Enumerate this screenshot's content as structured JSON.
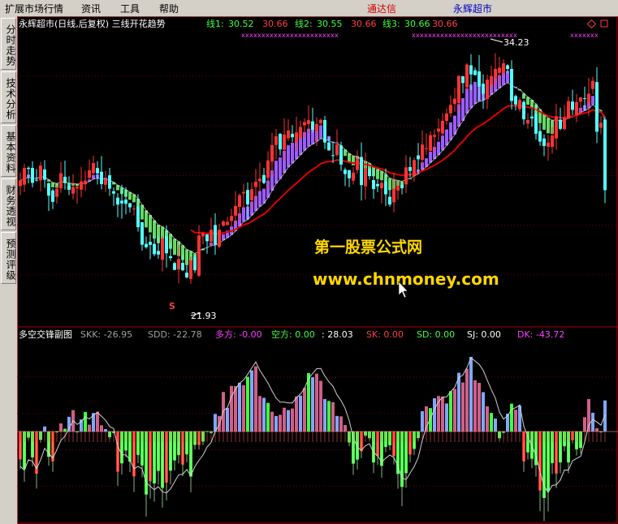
{
  "menubar": {
    "items": [
      "扩展市场行情",
      "资讯",
      "工具",
      "帮助"
    ],
    "brand_left": "通达信",
    "brand_right": "永辉超市"
  },
  "sidebar": {
    "tabs": [
      "分时走势",
      "技术分析",
      "基本资料",
      "财务透视",
      "预测评级"
    ]
  },
  "main_header": {
    "title": "永辉超市(日线,后复权) 三线开花趋势",
    "lines": [
      {
        "label": "线1:",
        "value": "30.52",
        "value2": "30.66"
      },
      {
        "label": "线2:",
        "value": "30.55",
        "value2": "30.66"
      },
      {
        "label": "线3:",
        "value": "30.66",
        "value2": "30.66"
      }
    ]
  },
  "annotations": {
    "high": "34.23",
    "low": "21.93",
    "signal": "S"
  },
  "watermark": {
    "line1": "第一股票公式网",
    "line2": "www.chnmoney.com"
  },
  "sub_header": {
    "title": "多空交锋副图",
    "items": [
      {
        "label": "SKK:",
        "value": "-26.95",
        "color": "#a0a0a0"
      },
      {
        "label": "SDD:",
        "value": "-22.78",
        "color": "#a0a0a0"
      },
      {
        "label": "多方:",
        "value": "-0.00",
        "color": "#ff40ff"
      },
      {
        "label": "空方:",
        "value": "0.00",
        "color": "#40ff40"
      },
      {
        "label": ":",
        "value": "28.03",
        "color": "#ffffff"
      },
      {
        "label": "SK:",
        "value": "0.00",
        "color": "#ff4040"
      },
      {
        "label": "SD:",
        "value": "0.00",
        "color": "#40ff40"
      },
      {
        "label": "SJ:",
        "value": "0.00",
        "color": "#ffffff"
      },
      {
        "label": "DK:",
        "value": "-43.72",
        "color": "#ff40ff"
      }
    ]
  },
  "chart_data": [
    {
      "type": "candlestick",
      "ylim": [
        19.5,
        35.5
      ],
      "x": [
        0,
        1,
        2,
        3,
        4,
        5,
        6,
        7,
        8,
        9,
        10,
        11,
        12,
        13,
        14,
        15,
        16,
        17,
        18,
        19,
        20,
        21,
        22,
        23,
        24,
        25,
        26,
        27,
        28,
        29,
        30,
        31,
        32,
        33,
        34,
        35,
        36,
        37,
        38,
        39,
        40,
        41,
        42,
        43,
        44,
        45,
        46,
        47,
        48,
        49,
        50,
        51,
        52,
        53,
        54,
        55,
        56,
        57,
        58,
        59,
        60,
        61,
        62,
        63,
        64,
        65,
        66,
        67,
        68,
        69,
        70,
        71,
        72,
        73,
        74,
        75,
        76,
        77,
        78,
        79,
        80,
        81,
        82,
        83,
        84,
        85,
        86,
        87,
        88,
        89,
        90,
        91,
        92,
        93,
        94,
        95,
        96,
        97,
        98,
        99,
        100,
        101,
        102,
        103,
        104,
        105,
        106,
        107,
        108,
        109,
        110,
        111,
        112,
        113,
        114,
        115,
        116,
        117,
        118,
        119,
        120,
        121,
        122,
        123,
        124,
        125,
        126,
        127,
        128,
        129,
        130,
        131,
        132,
        133,
        134,
        135,
        136,
        137,
        138,
        139,
        140,
        141,
        142,
        143,
        144
      ],
      "close": [
        27.39,
        28.08,
        28.02,
        27.26,
        27.4,
        28.2,
        27.43,
        26.56,
        26.22,
        26.93,
        27.79,
        27.29,
        26.88,
        27.04,
        27.04,
        27.34,
        27.38,
        27.95,
        28.34,
        27.78,
        27.19,
        27.47,
        26.94,
        26.67,
        26.07,
        26.13,
        26.11,
        25.92,
        25.85,
        24.83,
        23.87,
        23.73,
        23.86,
        23.35,
        23.33,
        24.21,
        23.4,
        23.14,
        22.49,
        23.09,
        22.47,
        22.08,
        23.01,
        22.47,
        24.38,
        24.49,
        24.06,
        24.69,
        23.89,
        24.69,
        25.14,
        25.12,
        25.44,
        25.99,
        26.58,
        26.76,
        26.07,
        26.91,
        27.32,
        27.49,
        27.25,
        28.49,
        29.33,
        29.81,
        29.09,
        29.91,
        30.13,
        29.76,
        30.02,
        30.32,
        30.59,
        30.69,
        30.17,
        30.48,
        30.71,
        29.47,
        29.04,
        28.75,
        29.37,
        28.26,
        27.74,
        27.51,
        27.82,
        28.6,
        27.14,
        28.06,
        27.63,
        26.92,
        27.07,
        27.26,
        26.63,
        26.07,
        26.94,
        27.11,
        26.98,
        28.11,
        27.91,
        28.51,
        28.55,
        29.36,
        29.16,
        29.87,
        29.88,
        30.23,
        30.66,
        31.06,
        31.53,
        31.87,
        33.13,
        32.73,
        33.74,
        33.2,
        33.16,
        32.54,
        32.14,
        32.91,
        33.11,
        33.5,
        33.56,
        33.81,
        33.5,
        31.75,
        31.55,
        31.8,
        30.74,
        30.7,
        30.79,
        29.95,
        29.52,
        29.28,
        29.47,
        29.86,
        30.9,
        30.23,
        30.84,
        31.74,
        31.26,
        31.68,
        31.94,
        31.88,
        32.14,
        32.85,
        30.06,
        30.55,
        26.86
      ],
      "up_color": "#ff3232",
      "down_color": "#54ffff"
    },
    {
      "type": "bar",
      "ylim": [
        -45,
        45
      ],
      "values": [
        -13.8,
        -18.4,
        -3.0,
        -12.8,
        -20.9,
        -4.1,
        2.5,
        -12.5,
        -14.8,
        -0.4,
        4.0,
        1.4,
        7.3,
        10.6,
        -0.3,
        6.0,
        9.7,
        3.4,
        9.2,
        9.8,
        3.1,
        1.2,
        -2.8,
        -0.7,
        -19.9,
        -15.8,
        -9.4,
        -14.9,
        -22.2,
        -11.6,
        -16.8,
        -31.2,
        -24.6,
        -25.7,
        -19.5,
        -27.9,
        -25.3,
        -19.4,
        -14.3,
        -11.7,
        -16.4,
        -11.3,
        -22.3,
        -6.6,
        -6.6,
        -5.0,
        0.2,
        -0.7,
        8.7,
        7.7,
        19.6,
        11.7,
        22.6,
        22.5,
        24.1,
        22.9,
        27.1,
        30.3,
        32.3,
        17.6,
        16.7,
        14.2,
        9.8,
        7.7,
        8.3,
        11.8,
        10.6,
        11.4,
        17.4,
        17.8,
        21.6,
        29.0,
        26.9,
        28.7,
        25.1,
        16.1,
        15.1,
        14.5,
        7.7,
        7.5,
        3.2,
        -5.4,
        -15.9,
        -13.9,
        -9.8,
        -2.0,
        -3.3,
        -15.3,
        -12.2,
        -17.0,
        -7.6,
        -6.8,
        -12.1,
        -21.0,
        -27.4,
        -20.6,
        -11.4,
        -8.6,
        -3.2,
        10.1,
        12.5,
        11.6,
        16.5,
        17.6,
        17.3,
        13.9,
        20.0,
        21.1,
        29.1,
        24.3,
        31.1,
        37.0,
        25.4,
        24.1,
        19.5,
        12.5,
        9.2,
        6.4,
        -3.3,
        -0.6,
        8.8,
        13.8,
        10.8,
        12.8,
        -14.8,
        -10.3,
        -13.5,
        -16.6,
        -29.2,
        -32.9,
        -29.3,
        -15.6,
        -20.8,
        -15.3,
        -7.3,
        -15.3,
        -4.3,
        -8.8,
        -8.1,
        7.1,
        16.1,
        9.3,
        1.7,
        -0.1,
        15.4
      ]
    }
  ]
}
